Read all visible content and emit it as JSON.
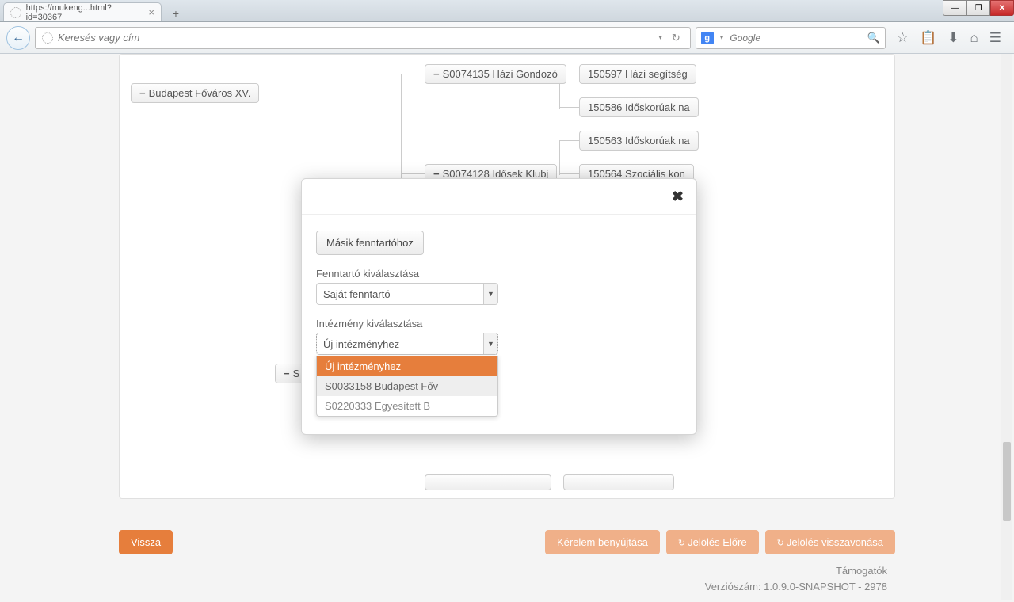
{
  "window": {
    "tab_title": "https://mukeng...html?id=30367"
  },
  "nav": {
    "url_placeholder": "Keresés vagy cím",
    "search_placeholder": "Google"
  },
  "tree": {
    "root": "Budapest Főváros XV.",
    "n1": "S0074135 Házi Gondozó",
    "n1a": "150597 Házi segítség",
    "n1b": "150586 Időskorúak na",
    "n2": "S0074128 Idősek Klubj",
    "n2a": "150563 Időskorúak na",
    "n2b": "150564 Szociális kon",
    "n3prefix": "S"
  },
  "modal": {
    "other_maintainer_btn": "Másik fenntartóhoz",
    "maintainer_label": "Fenntartó kiválasztása",
    "maintainer_value": "Saját fenntartó",
    "institution_label": "Intézmény kiválasztása",
    "institution_value": "Új intézményhez",
    "options": {
      "o1": "Új intézményhez",
      "o2": "S0033158 Budapest Főv",
      "o3": "S0220333 Egyesített B"
    }
  },
  "footer": {
    "back": "Vissza",
    "submit": "Kérelem benyújtása",
    "fwd": "Jelölés Előre",
    "undo": "Jelölés visszavonása",
    "sponsors": "Támogatók",
    "version": "Verziószám: 1.0.9.0-SNAPSHOT - 2978"
  }
}
